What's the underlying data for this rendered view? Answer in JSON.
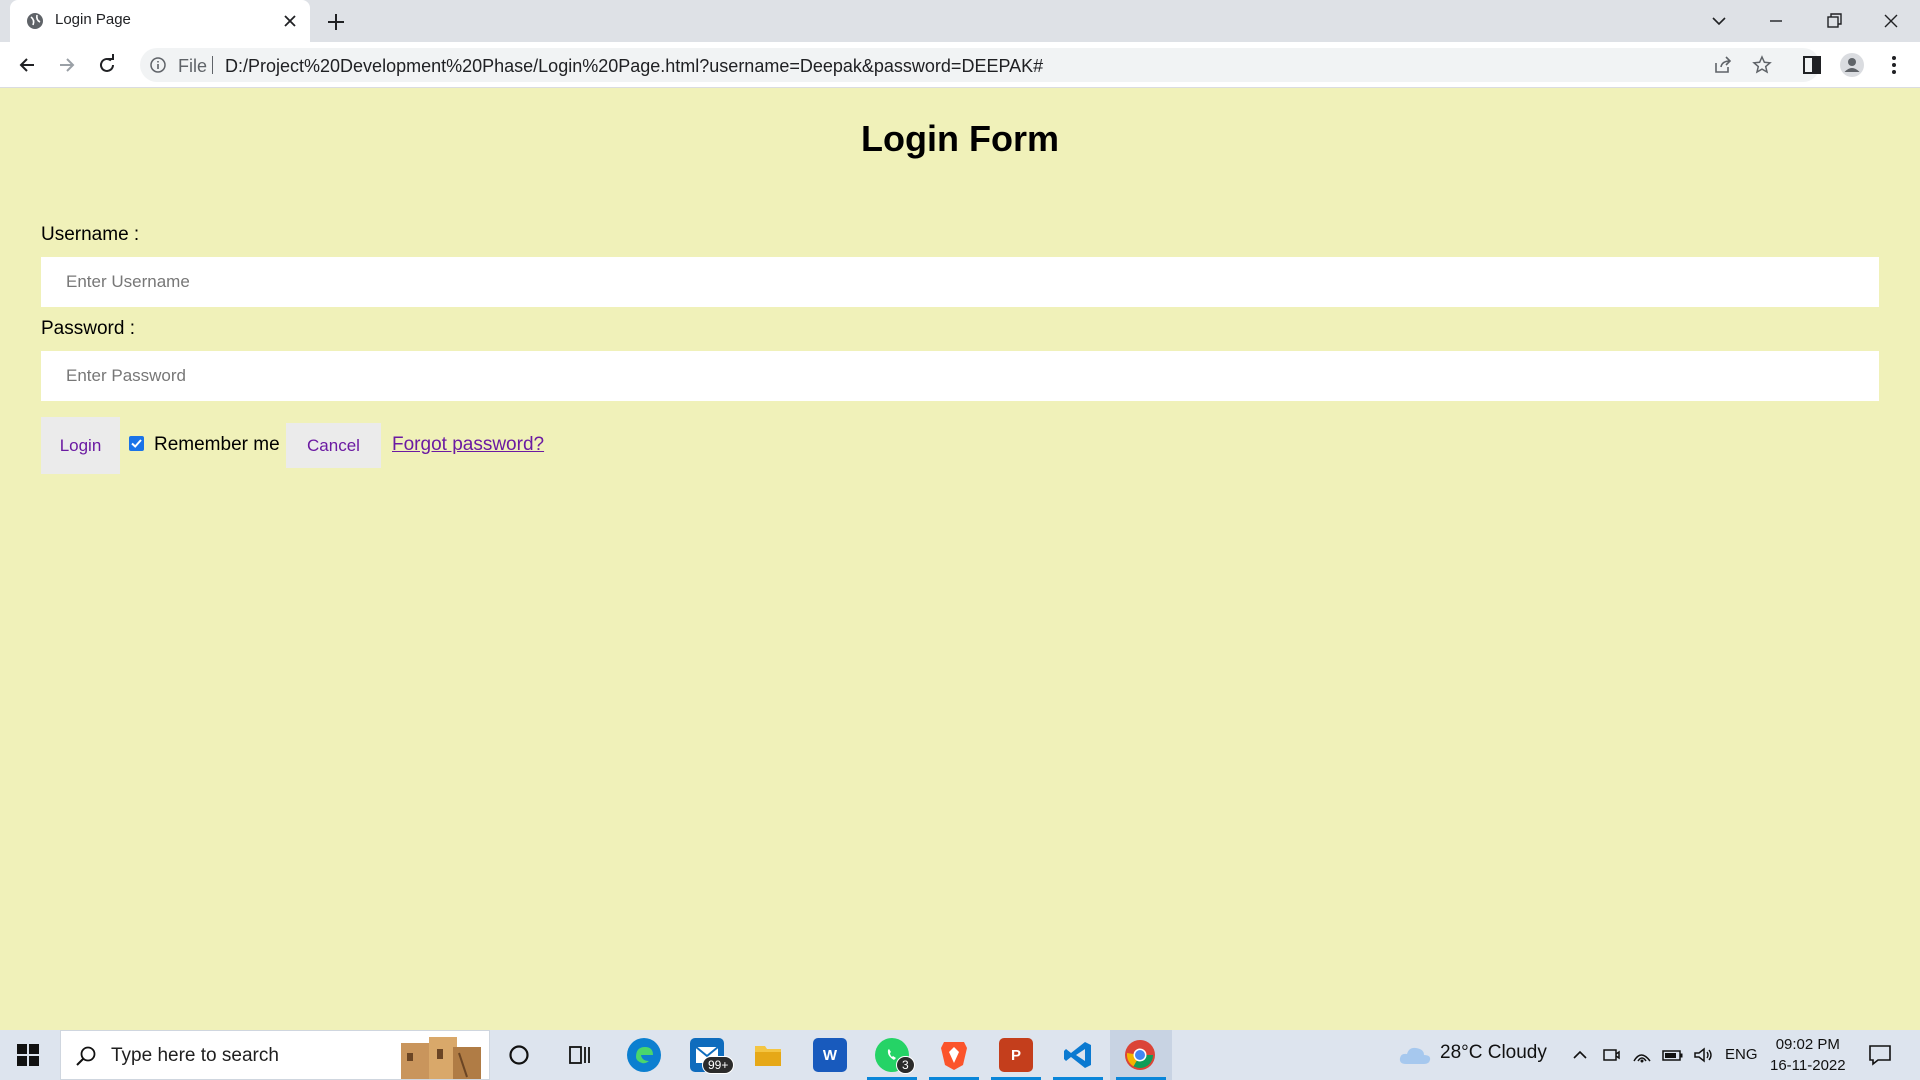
{
  "browser": {
    "tab_title": "Login Page",
    "url_scheme_label": "File",
    "url": "D:/Project%20Development%20Phase/Login%20Page.html?username=Deepak&password=DEEPAK#"
  },
  "page": {
    "title": "Login Form",
    "username_label": "Username :",
    "username_placeholder": "Enter Username",
    "password_label": "Password :",
    "password_placeholder": "Enter Password",
    "login_button": "Login",
    "remember_label": "Remember me",
    "remember_checked": true,
    "cancel_button": "Cancel",
    "forgot_link": "Forgot password?"
  },
  "taskbar": {
    "search_placeholder": "Type here to search",
    "mail_badge": "99+",
    "whatsapp_badge": "3",
    "weather": "28°C  Cloudy",
    "language": "ENG",
    "time": "09:02 PM",
    "date": "16-11-2022"
  },
  "colors": {
    "page_background": "#f0f1b9",
    "link": "#6b1aa2",
    "checkbox": "#1a73e8"
  }
}
